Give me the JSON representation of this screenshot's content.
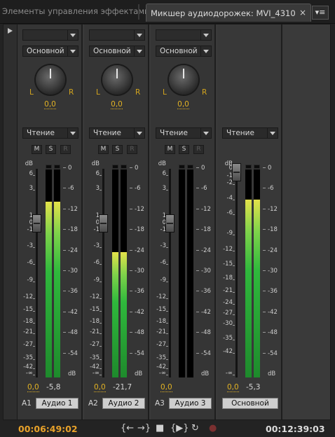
{
  "tabs": {
    "inactive": "Элементы управления эффектами",
    "active": "Микшер аудиодорожек: MVI_4310",
    "close": "×",
    "menu": "▾≡"
  },
  "fader_scale": [
    "dB",
    "6",
    "3",
    "1",
    "0",
    "-1",
    "-3",
    "-6",
    "-9",
    "-12",
    "-15",
    "-18",
    "-21",
    "-27",
    "-35",
    "-42",
    "-∞"
  ],
  "master_fader_scale": [
    "dB",
    "0",
    "-1",
    "-2",
    "-4",
    "-6",
    "-9",
    "-12",
    "-15",
    "-18",
    "-21",
    "-24",
    "-27",
    "-30",
    "-35",
    "-42",
    "-∞"
  ],
  "meter_scale": [
    "0",
    "-6",
    "-12",
    "-18",
    "-24",
    "-30",
    "-36",
    "-42",
    "-48",
    "-54",
    "dB"
  ],
  "tracks": [
    {
      "mode_empty": "",
      "group": "Основной",
      "pan_l": "L",
      "pan_r": "R",
      "pan_value": "0,0",
      "automation": "Чтение",
      "m": "M",
      "s": "S",
      "r": "R",
      "volume": "0,0",
      "peak": "-5,8",
      "id": "A1",
      "name": "Аудио 1",
      "level": 0.845
    },
    {
      "mode_empty": "",
      "group": "Основной",
      "pan_l": "L",
      "pan_r": "R",
      "pan_value": "0,0",
      "automation": "Чтение",
      "m": "M",
      "s": "S",
      "r": "R",
      "volume": "0,0",
      "peak": "-21,7",
      "id": "A2",
      "name": "Аудио 2",
      "level": 0.604
    },
    {
      "mode_empty": "",
      "group": "Основной",
      "pan_l": "L",
      "pan_r": "R",
      "pan_value": "0,0",
      "automation": "Чтение",
      "m": "M",
      "s": "S",
      "r": "R",
      "volume": "0,0",
      "peak": "",
      "id": "A3",
      "name": "Аудио 3",
      "level": 0.0
    }
  ],
  "master": {
    "automation": "Чтение",
    "volume": "0,0",
    "peak": "-5,3",
    "name": "Основной",
    "level": 0.855
  },
  "transport": {
    "current_time": "00:06:49:02",
    "duration": "00:12:39:03",
    "btn_in": "{←",
    "btn_out": "→}",
    "btn_stop": "■",
    "btn_play_inout": "{▶}",
    "btn_loop": "↻",
    "btn_record": "●"
  },
  "colors": {
    "timecode": "#e8a22a",
    "value": "#e2b224",
    "meter_green": "#2fb83c",
    "meter_yellow": "#e4e24a"
  }
}
